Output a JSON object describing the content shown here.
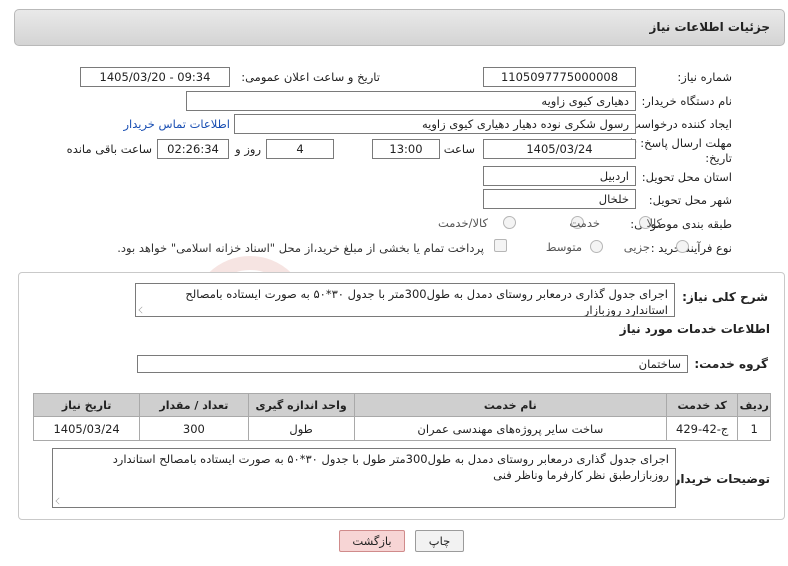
{
  "header": {
    "title": "جزئیات اطلاعات نیاز"
  },
  "fields": {
    "need_number_label": "شماره نیاز:",
    "need_number": "1105097775000008",
    "announce_label": "تاریخ و ساعت اعلان عمومی:",
    "announce_value": "1405/03/20 - 09:34",
    "buyer_org_label": "نام دستگاه خریدار:",
    "buyer_org": "دهیاری کیوی زاویه",
    "creator_label": "ایجاد کننده درخواست:",
    "creator": "رسول شکری نوده دهیار دهیاری کیوی زاویه",
    "contact_link": "اطلاعات تماس خریدار",
    "deadline_label": "مهلت ارسال پاسخ: تا تاریخ:",
    "deadline_date": "1405/03/24",
    "time_label": "ساعت",
    "deadline_time": "13:00",
    "days_value": "4",
    "days_label": "روز و",
    "remaining_time": "02:26:34",
    "remaining_label": "ساعت باقی مانده",
    "province_label": "استان محل تحویل:",
    "province": "اردبیل",
    "city_label": "شهر محل تحویل:",
    "city": "خلخال",
    "category_label": "طبقه بندی موضوعی:",
    "category_options": [
      "کالا",
      "خدمت",
      "کالا/خدمت"
    ],
    "process_label": "نوع فرآیند خرید :",
    "process_options": [
      "جزیی",
      "متوسط"
    ],
    "payment_note": "پرداخت تمام یا بخشی از مبلغ خرید،از محل \"اسناد خزانه اسلامی\" خواهد بود."
  },
  "summary": {
    "label": "شرح کلی نیاز:",
    "text": "اجرای جدول گذاری درمعابر روستای دمدل به طول300متر با جدول ۳۰*۵۰ به صورت ایستاده بامصالح استاندارد روزبازار"
  },
  "services": {
    "section_title": "اطلاعات خدمات مورد نیاز",
    "group_label": "گروه خدمت:",
    "group_value": "ساختمان",
    "columns": [
      "ردیف",
      "کد خدمت",
      "نام خدمت",
      "واحد اندازه گیری",
      "تعداد / مقدار",
      "تاریخ نیاز"
    ],
    "rows": [
      [
        "1",
        "ج-42-429",
        "ساخت سایر پروژه‌های مهندسی عمران",
        "طول",
        "300",
        "1405/03/24"
      ]
    ]
  },
  "buyer_notes": {
    "label": "توضیحات خریدار:",
    "text": "اجرای جدول گذاری درمعابر روستای دمدل به طول300متر طول با جدول ۳۰*۵۰ به صورت ایستاده بامصالح استاندارد روزبازارطبق نظر کارفرما وناظر فنی"
  },
  "buttons": {
    "print": "چاپ",
    "back": "بازگشت"
  },
  "watermark": {
    "text": "AriaTender.neT"
  },
  "colors": {
    "link": "#1a4fb3",
    "watermark": "#c0392b",
    "back_button_bg": "#f7d5d5",
    "header_bg": "#dcdcdc"
  }
}
